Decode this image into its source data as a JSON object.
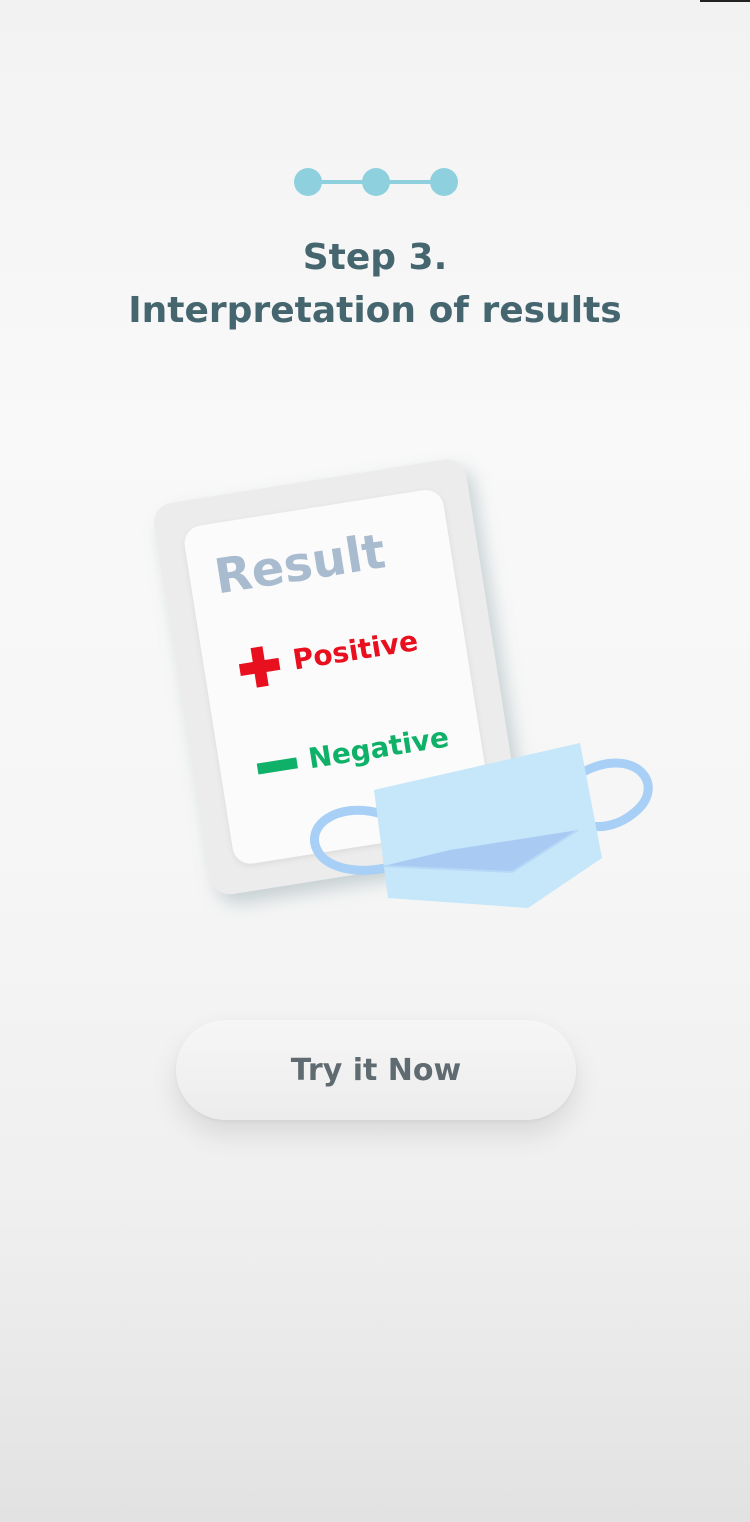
{
  "onboarding": {
    "step_indicator": {
      "total_steps": 3,
      "current_step": 3
    },
    "title_line1": "Step 3.",
    "title_line2": "Interpretation of results",
    "illustration": {
      "card_title": "Result",
      "positive_label": "Positive",
      "negative_label": "Negative",
      "colors": {
        "positive": "#e8101e",
        "negative": "#0fb168",
        "card_title": "#a9bbcf",
        "mask": "#c5e7f9",
        "mask_strap": "#a8cff5"
      }
    },
    "cta_label": "Try it Now",
    "accent_color": "#8fd0df"
  }
}
